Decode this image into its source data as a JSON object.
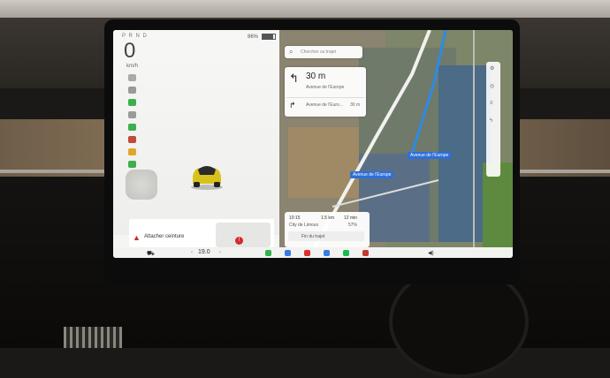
{
  "status": {
    "gear": "P R N D",
    "battery_percent": 86,
    "battery_label": "86%",
    "speed": "0",
    "speed_unit": "km/h"
  },
  "alert": {
    "text": "Attacher ceinture",
    "icon": "warning-triangle-icon"
  },
  "navigation": {
    "search_placeholder": "Chercher ou trajet",
    "next_turn": {
      "distance": "30 m",
      "street": "Avenue de l'Europe",
      "icon": "turn-left-arrow-icon"
    },
    "following_turn": {
      "street": "Avenue de l'Euro...",
      "distance": "30 m",
      "icon": "slight-right-arrow-icon"
    },
    "map_labels": [
      "Avenue de l'Europe",
      "Avenue de l'Europe"
    ],
    "trip": {
      "arrival": "10:15",
      "distance": "1.5 km",
      "minutes": "12 min",
      "destination": "City de Limoux",
      "charge": "57%",
      "end_label": "Fin du trajet"
    }
  },
  "taskbar": {
    "temperature": "19.0",
    "apps": [
      "phone",
      "messages",
      "calendar",
      "bluetooth",
      "spotify",
      "joystick"
    ],
    "app_colors": [
      "#2fb34a",
      "#3a7be0",
      "#d8322c",
      "#3a7be0",
      "#1db954",
      "#c23b2f"
    ]
  },
  "colors": {
    "route": "#2e8ae6",
    "alert": "#d12b2b",
    "car_body": "#d8c21a"
  }
}
